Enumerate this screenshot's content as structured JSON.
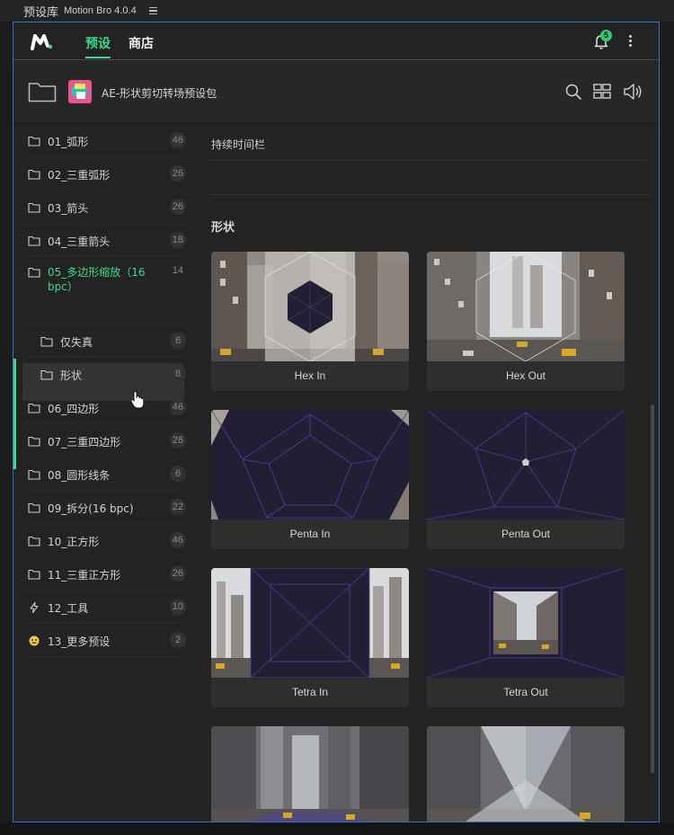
{
  "window": {
    "title": "预设库",
    "app": "Motion Bro 4.0.4"
  },
  "nav": {
    "tabs": [
      {
        "label": "预设"
      },
      {
        "label": "商店"
      }
    ],
    "notification_count": "5"
  },
  "package": {
    "title": "AE-形状剪切转场预设包"
  },
  "sidebar": {
    "items": [
      {
        "label": "01_弧形",
        "count": "46",
        "icon": "folder-icon"
      },
      {
        "label": "02_三重弧形",
        "count": "26",
        "icon": "folder-icon"
      },
      {
        "label": "03_箭头",
        "count": "26",
        "icon": "folder-icon"
      },
      {
        "label": "04_三重箭头",
        "count": "18",
        "icon": "folder-icon"
      },
      {
        "label": "05_多边形缩放（16 bpc）",
        "count": "14",
        "icon": "folder-icon",
        "selected": true
      },
      {
        "label": "仅失真",
        "count": "6",
        "icon": "folder-icon",
        "sub": true
      },
      {
        "label": "形状",
        "count": "8",
        "icon": "folder-icon",
        "sub": true
      },
      {
        "label": "06_四边形",
        "count": "46",
        "icon": "folder-icon"
      },
      {
        "label": "07_三重四边形",
        "count": "26",
        "icon": "folder-icon"
      },
      {
        "label": "08_圆形线条",
        "count": "6",
        "icon": "folder-icon"
      },
      {
        "label": "09_拆分(16 bpc)",
        "count": "22",
        "icon": "folder-icon"
      },
      {
        "label": "10_正方形",
        "count": "46",
        "icon": "folder-icon"
      },
      {
        "label": "11_三重正方形",
        "count": "26",
        "icon": "folder-icon"
      },
      {
        "label": "12_工具",
        "count": "10",
        "icon": "lightning-icon"
      },
      {
        "label": "13_更多预设",
        "count": "2",
        "icon": "emoji-icon"
      }
    ]
  },
  "content": {
    "duration_label": "持续时间栏",
    "section_title": "形状",
    "presets": [
      "Hex In",
      "Hex Out",
      "Penta In",
      "Penta Out",
      "Tetra In",
      "Tetra Out"
    ]
  },
  "colors": {
    "accent": "#3fd98a",
    "panel_border": "#3a6fd1",
    "shape_fill": "#221e33"
  }
}
